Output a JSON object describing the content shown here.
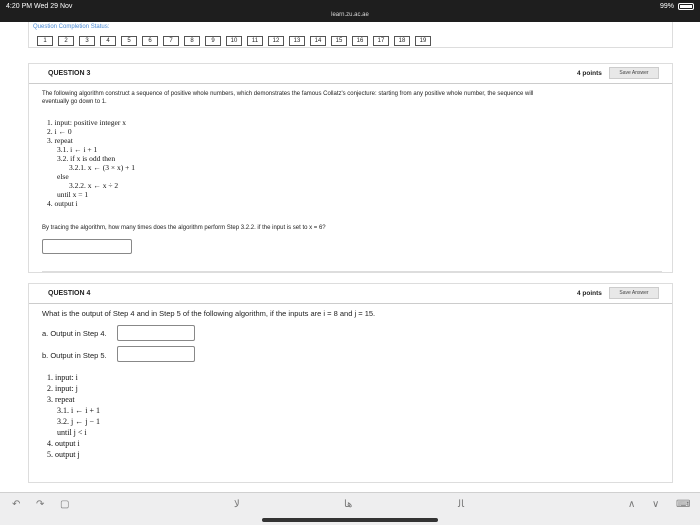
{
  "status": {
    "time": "4:20 PM  Wed 29 Nov",
    "url": "learn.zu.ac.ae",
    "battery": "99%"
  },
  "completion": {
    "title": "Question Completion Status:",
    "numbers": [
      "1",
      "2",
      "3",
      "4",
      "5",
      "6",
      "7",
      "8",
      "9",
      "10",
      "11",
      "12",
      "13",
      "14",
      "15",
      "16",
      "17",
      "18",
      "19"
    ]
  },
  "q3": {
    "title": "QUESTION 3",
    "points": "4 points",
    "save": "Save Answer",
    "prompt": "The following algorithm construct a sequence of positive whole numbers, which demonstrates the famous Collatz's conjecture: starting from any positive whole number, the sequence will eventually go down to 1.",
    "algorithm": [
      "1. input: positive integer x",
      "2. i ← 0",
      "3. repeat",
      "3.1. i ← i + 1",
      "3.2. if x is odd then",
      "3.2.1. x ← (3 × x) + 1",
      "else",
      "3.2.2. x ← x ÷ 2",
      "until x = 1",
      "4. output i"
    ],
    "question": "By tracing the algorithm, how many times does the algorithm perform Step 3.2.2. if the input is set to x = 6?"
  },
  "q4": {
    "title": "QUESTION 4",
    "points": "4 points",
    "save": "Save Answer",
    "question": "What is the output of Step 4 and in Step 5 of the following algorithm, if the inputs are i = 8 and j = 15.",
    "label_a": "a. Output in Step 4.",
    "label_b": "b. Output in Step 5.",
    "algorithm": [
      "1. input: i",
      "2. input: j",
      "3. repeat",
      "3.1. i ← i + 1",
      "3.2. j ← j − 1",
      "until j < i",
      "4. output i",
      "5. output j"
    ]
  },
  "toolbar": {
    "undo": "↶",
    "redo": "↷",
    "clip": "▢",
    "key1": "ﻻ",
    "key2": "ﻫﺎ",
    "key3": "ﺎﻟ",
    "up": "∧",
    "down": "∨",
    "keyboard": "⌨"
  }
}
